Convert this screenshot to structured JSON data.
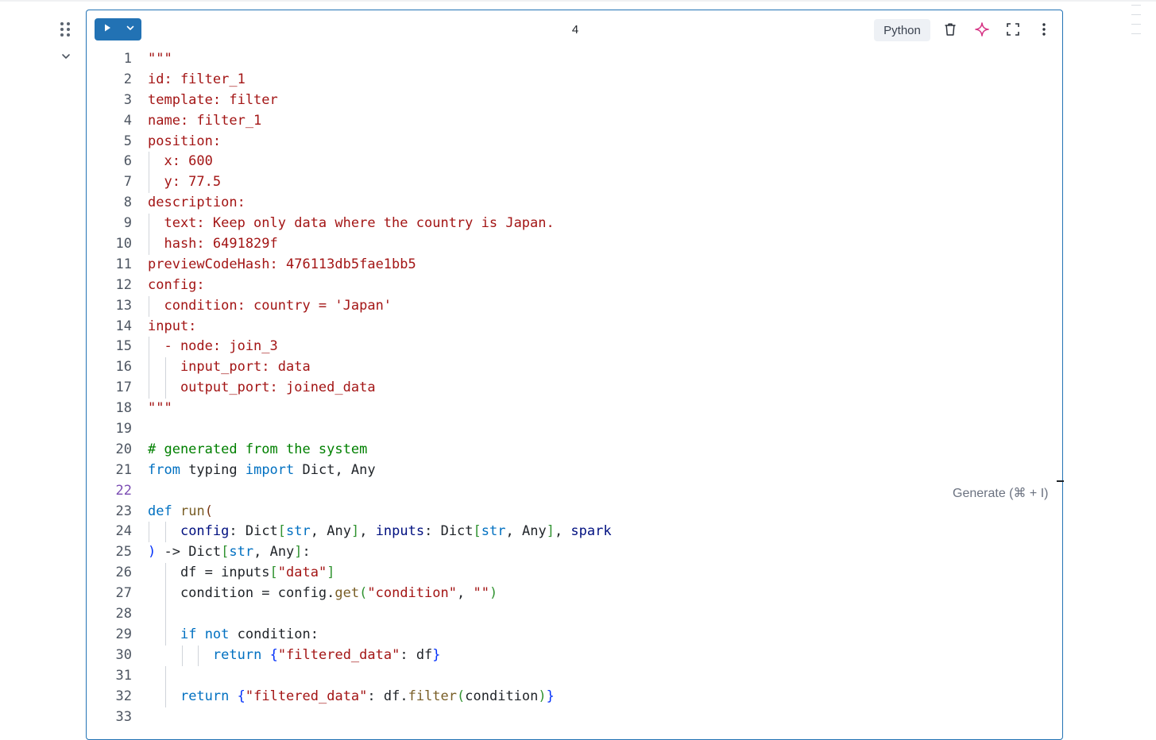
{
  "cell": {
    "number": "4",
    "language": "Python",
    "run_icon": "play-icon",
    "run_menu_icon": "chevron-down-icon",
    "toolbar_icons": [
      "trash-icon",
      "sparkle-icon",
      "expand-icon",
      "more-vertical-icon"
    ],
    "generate_hint": "Generate (⌘ + I)",
    "active_line": 22
  },
  "colors": {
    "accent": "#2272b4",
    "string": "#a31515",
    "comment": "#008000",
    "keyword": "#0000ff",
    "sparkle": "#d63384"
  },
  "code": {
    "lines": [
      {
        "n": "1",
        "t": "\"\"\""
      },
      {
        "n": "2",
        "t": "id: filter_1"
      },
      {
        "n": "3",
        "t": "template: filter"
      },
      {
        "n": "4",
        "t": "name: filter_1"
      },
      {
        "n": "5",
        "t": "position:"
      },
      {
        "n": "6",
        "t": "  x: 600"
      },
      {
        "n": "7",
        "t": "  y: 77.5"
      },
      {
        "n": "8",
        "t": "description:"
      },
      {
        "n": "9",
        "t": "  text: Keep only data where the country is Japan."
      },
      {
        "n": "10",
        "t": "  hash: 6491829f"
      },
      {
        "n": "11",
        "t": "previewCodeHash: 476113db5fae1bb5"
      },
      {
        "n": "12",
        "t": "config:"
      },
      {
        "n": "13",
        "t": "  condition: country = 'Japan'"
      },
      {
        "n": "14",
        "t": "input:"
      },
      {
        "n": "15",
        "t": "  - node: join_3"
      },
      {
        "n": "16",
        "t": "    input_port: data"
      },
      {
        "n": "17",
        "t": "    output_port: joined_data"
      },
      {
        "n": "18",
        "t": "\"\"\""
      },
      {
        "n": "19",
        "t": ""
      },
      {
        "n": "20",
        "t": "# generated from the system"
      },
      {
        "n": "21",
        "t": "from typing import Dict, Any"
      },
      {
        "n": "22",
        "t": ""
      },
      {
        "n": "23",
        "t": "def run("
      },
      {
        "n": "24",
        "t": "    config: Dict[str, Any], inputs: Dict[str, Any], spark"
      },
      {
        "n": "25",
        "t": ") -> Dict[str, Any]:"
      },
      {
        "n": "26",
        "t": "    df = inputs[\"data\"]"
      },
      {
        "n": "27",
        "t": "    condition = config.get(\"condition\", \"\")"
      },
      {
        "n": "28",
        "t": ""
      },
      {
        "n": "29",
        "t": "    if not condition:"
      },
      {
        "n": "30",
        "t": "        return {\"filtered_data\": df}"
      },
      {
        "n": "31",
        "t": ""
      },
      {
        "n": "32",
        "t": "    return {\"filtered_data\": df.filter(condition)}"
      },
      {
        "n": "33",
        "t": ""
      }
    ]
  }
}
